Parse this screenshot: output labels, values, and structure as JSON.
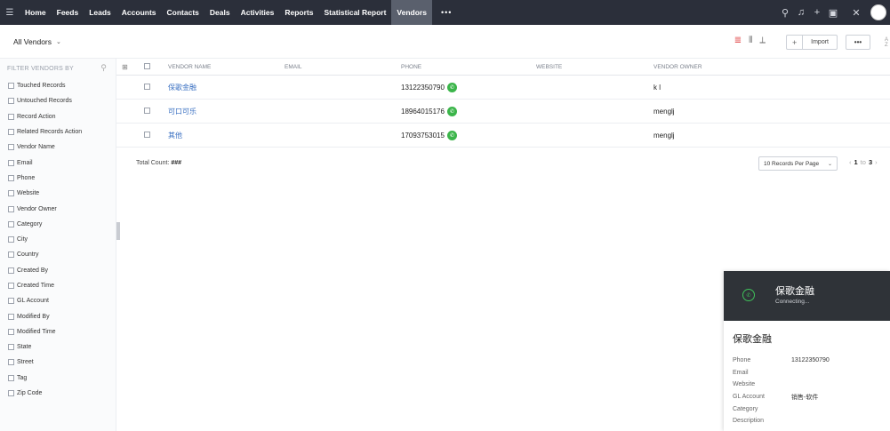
{
  "nav": {
    "items": [
      "Home",
      "Feeds",
      "Leads",
      "Accounts",
      "Contacts",
      "Deals",
      "Activities",
      "Reports",
      "Statistical Report",
      "Vendors"
    ],
    "active": "Vendors",
    "more": "•••"
  },
  "subheader": {
    "view": "All Vendors",
    "import_label": "Import",
    "more_label": "•••",
    "sort": "A Z"
  },
  "sidebar": {
    "title": "FILTER VENDORS BY",
    "filters": [
      "Touched Records",
      "Untouched Records",
      "Record Action",
      "Related Records Action",
      "Vendor Name",
      "Email",
      "Phone",
      "Website",
      "Vendor Owner",
      "Category",
      "City",
      "Country",
      "Created By",
      "Created Time",
      "GL Account",
      "Modified By",
      "Modified Time",
      "State",
      "Street",
      "Tag",
      "Zip Code"
    ]
  },
  "table": {
    "columns": {
      "name": "VENDOR NAME",
      "email": "EMAIL",
      "phone": "PHONE",
      "website": "WEBSITE",
      "owner": "VENDOR OWNER"
    },
    "rows": [
      {
        "name": "保歌金融",
        "email": "",
        "phone": "13122350790",
        "website": "",
        "owner": "k l"
      },
      {
        "name": "可口可乐",
        "email": "",
        "phone": "18964015176",
        "website": "",
        "owner": "menglj"
      },
      {
        "name": "其他",
        "email": "",
        "phone": "17093753015",
        "website": "",
        "owner": "menglj"
      }
    ],
    "total_label": "Total Count:",
    "total_value": "###",
    "per_page": "10 Records Per Page",
    "pager": {
      "from": "1",
      "to_word": "to",
      "to": "3"
    }
  },
  "call_panel": {
    "name": "保歌金融",
    "status": "Connecting...",
    "title": "保歌金融",
    "fields": [
      {
        "label": "Phone",
        "value": "13122350790"
      },
      {
        "label": "Email",
        "value": ""
      },
      {
        "label": "Website",
        "value": ""
      },
      {
        "label": "GL Account",
        "value": "销售-软件"
      },
      {
        "label": "Category",
        "value": ""
      },
      {
        "label": "Description",
        "value": ""
      }
    ]
  }
}
